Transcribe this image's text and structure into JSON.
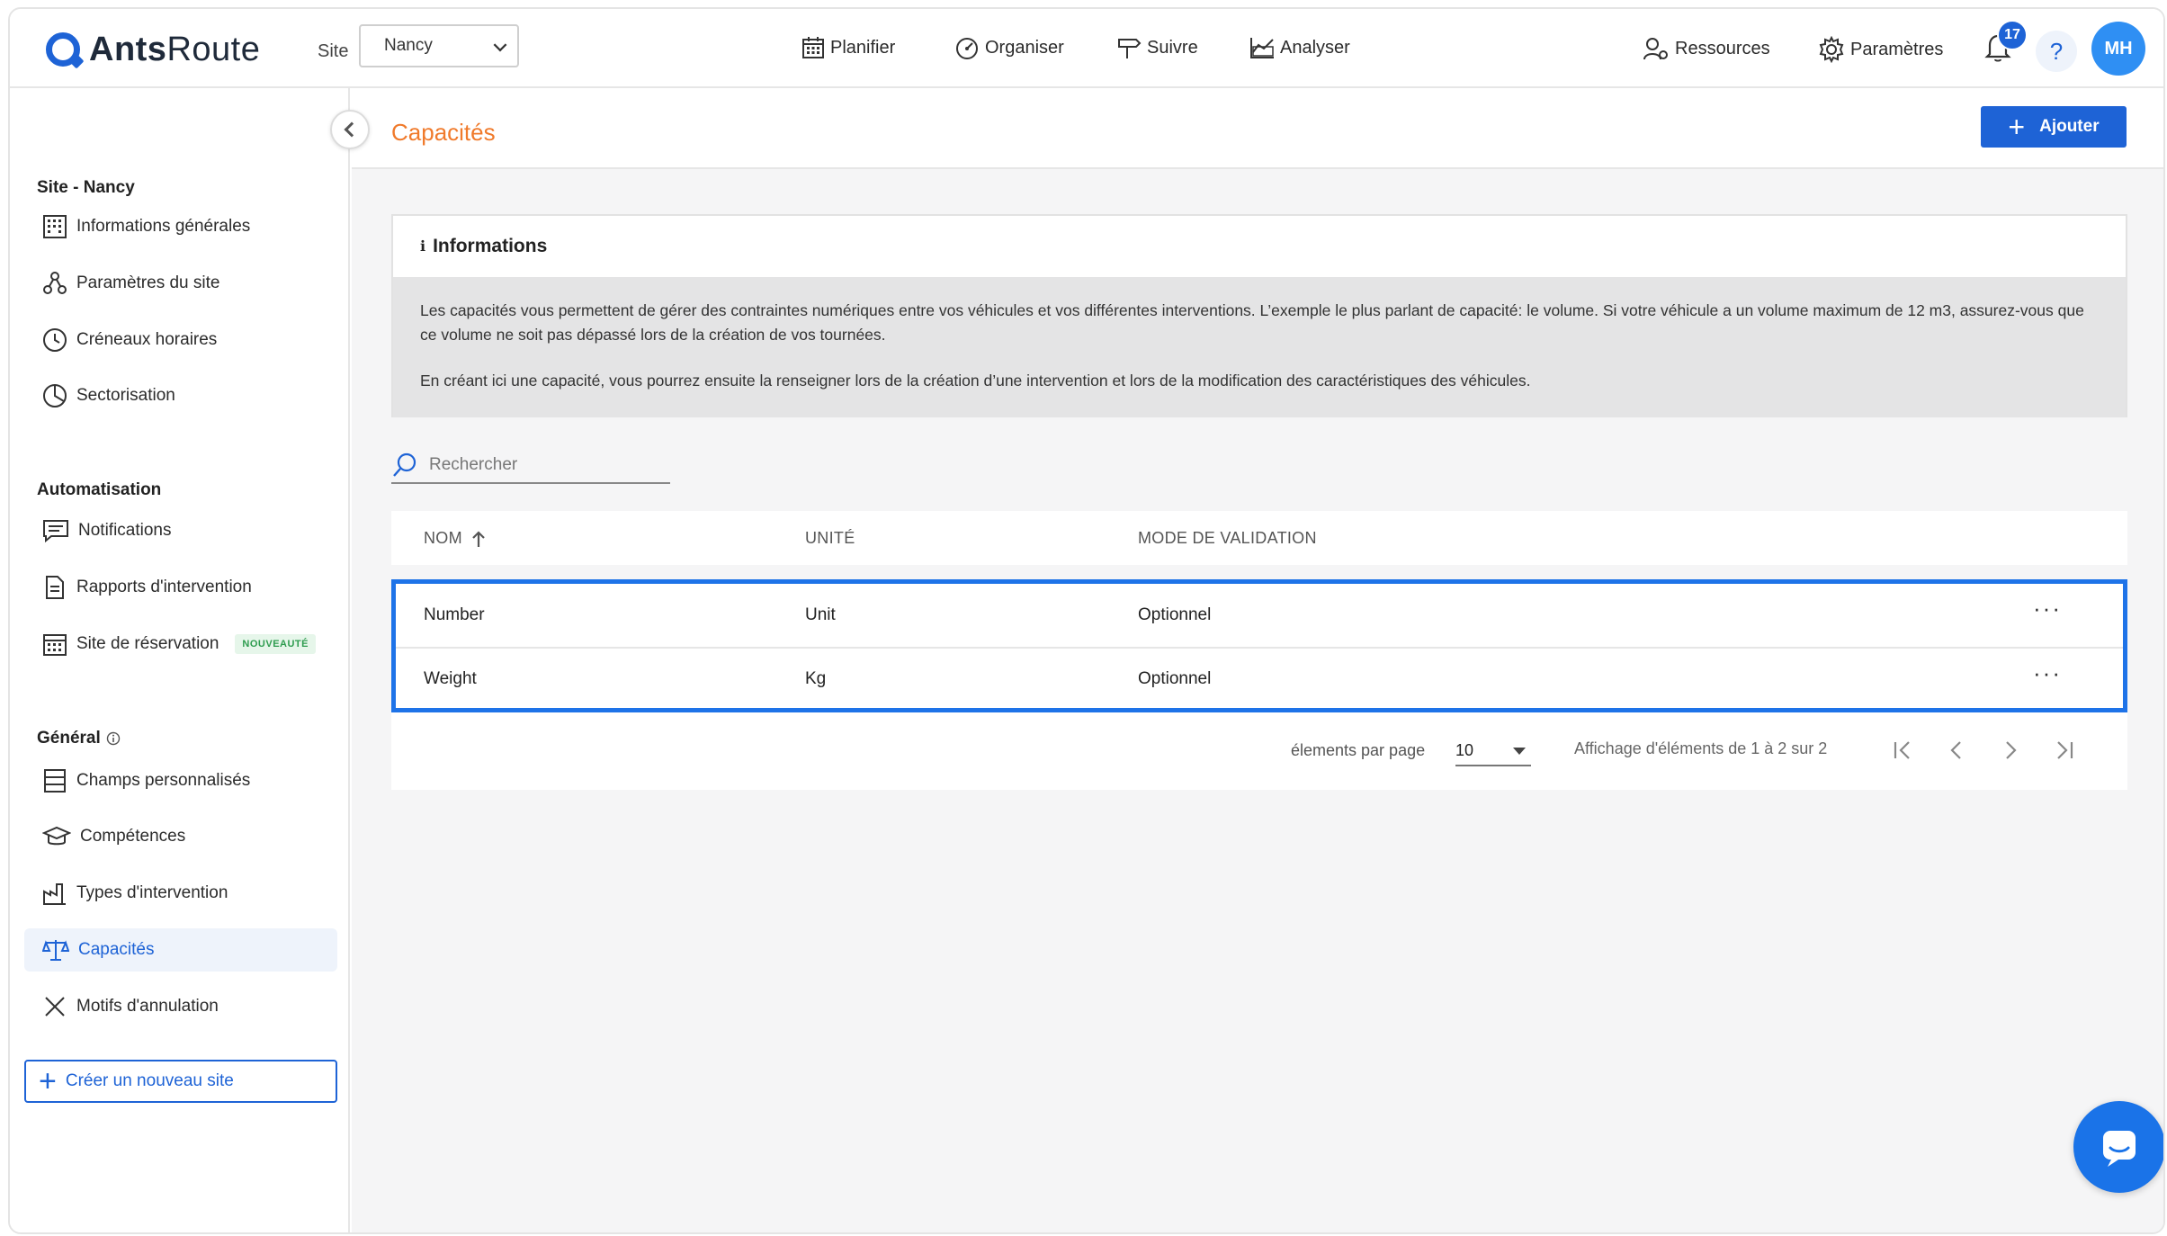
{
  "brand": {
    "name_bold": "Ants",
    "name_rest": "Route"
  },
  "topbar": {
    "site_label": "Site",
    "site_value": "Nancy",
    "nav": [
      {
        "label": "Planifier",
        "icon": "calendar-icon"
      },
      {
        "label": "Organiser",
        "icon": "gauge-icon"
      },
      {
        "label": "Suivre",
        "icon": "signpost-icon"
      },
      {
        "label": "Analyser",
        "icon": "chart-icon"
      }
    ],
    "resources_label": "Ressources",
    "settings_label": "Paramètres",
    "notification_count": "17",
    "help_label": "?",
    "avatar_initials": "MH"
  },
  "sidebar": {
    "section_site": "Site - Nancy",
    "site_items": [
      {
        "label": "Informations générales",
        "icon": "building-icon"
      },
      {
        "label": "Paramètres du site",
        "icon": "nodes-icon"
      },
      {
        "label": "Créneaux horaires",
        "icon": "clock-icon"
      },
      {
        "label": "Sectorisation",
        "icon": "pie-icon"
      }
    ],
    "section_automation": "Automatisation",
    "automation_items": [
      {
        "label": "Notifications",
        "icon": "message-icon"
      },
      {
        "label": "Rapports d'intervention",
        "icon": "document-icon"
      },
      {
        "label": "Site de réservation",
        "icon": "calendar-grid-icon",
        "badge": "NOUVEAUTÉ"
      }
    ],
    "section_general": "Général",
    "general_items": [
      {
        "label": "Champs personnalisés",
        "icon": "form-icon"
      },
      {
        "label": "Compétences",
        "icon": "graduation-cap-icon"
      },
      {
        "label": "Types d'intervention",
        "icon": "factory-icon"
      },
      {
        "label": "Capacités",
        "icon": "scale-icon",
        "active": true
      },
      {
        "label": "Motifs d'annulation",
        "icon": "x-icon"
      }
    ],
    "create_site_label": "Créer un nouveau site"
  },
  "page": {
    "title": "Capacités",
    "add_button": "Ajouter",
    "info_title": "Informations",
    "info_paragraph_1": "Les capacités vous permettent de gérer des contraintes numériques entre vos véhicules et vos différentes interventions. L’exemple le plus parlant de capacité: le volume. Si votre véhicule a un volume maximum de 12 m3, assurez-vous que ce volume ne soit pas dépassé lors de la création de vos tournées.",
    "info_paragraph_2": "En créant ici une capacité, vous pourrez ensuite la renseigner lors de la création d’une intervention et lors de la modification des caractéristiques des véhicules.",
    "search_placeholder": "Rechercher"
  },
  "table": {
    "columns": [
      "NOM",
      "UNITÉ",
      "MODE DE VALIDATION"
    ],
    "rows": [
      {
        "name": "Number",
        "unit": "Unit",
        "mode": "Optionnel"
      },
      {
        "name": "Weight",
        "unit": "Kg",
        "mode": "Optionnel"
      }
    ],
    "row_menu": "···"
  },
  "pagination": {
    "per_page_label": "élements par page",
    "per_page_value": "10",
    "range_text": "Affichage d'éléments de 1 à 2 sur 2"
  },
  "colors": {
    "accent": "#1e63d6",
    "title": "#f07a2b",
    "selection": "#1e73e8"
  }
}
